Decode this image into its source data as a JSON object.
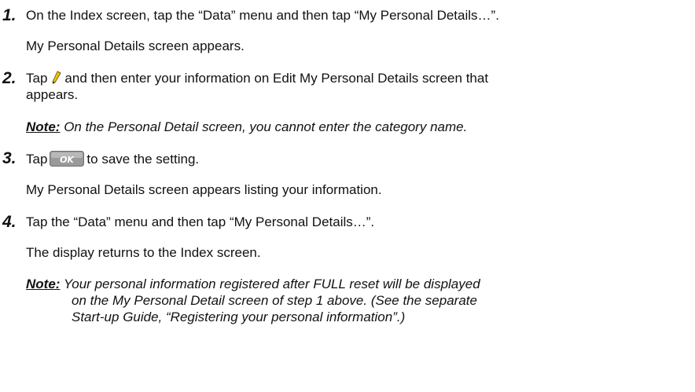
{
  "steps": [
    {
      "number": "1.",
      "text": "On the Index screen, tap the “Data” menu and then tap “My Personal Details…”.",
      "result": "My Personal Details screen appears."
    },
    {
      "number": "2.",
      "before_icon": "Tap",
      "icon": "edit-pencil-icon",
      "after_icon_line1": "and then enter your information on Edit My Personal Details screen that",
      "line2": "appears.",
      "note_label": "Note:",
      "note_text": "On the Personal Detail screen, you cannot enter the category name."
    },
    {
      "number": "3.",
      "before_icon": "Tap",
      "button_label": "OK",
      "after_icon": "to save the setting.",
      "result": "My Personal Details screen appears listing your information."
    },
    {
      "number": "4.",
      "text": "Tap the “Data” menu and then tap “My Personal Details…”.",
      "result": "The display returns to the Index screen.",
      "note_label": "Note:",
      "note_line1": "Your personal information registered after FULL reset will be displayed",
      "note_line2": "on the My Personal Detail screen of step 1 above. (See the separate",
      "note_line3": "Start-up Guide, “Registering your personal information”.)"
    }
  ],
  "colors": {
    "text": "#111111",
    "ok_button_bg": "#9a9a9a",
    "ok_button_text": "#ffffff",
    "pencil_body": "#f2c400",
    "pencil_tip": "#2a2a2a"
  }
}
